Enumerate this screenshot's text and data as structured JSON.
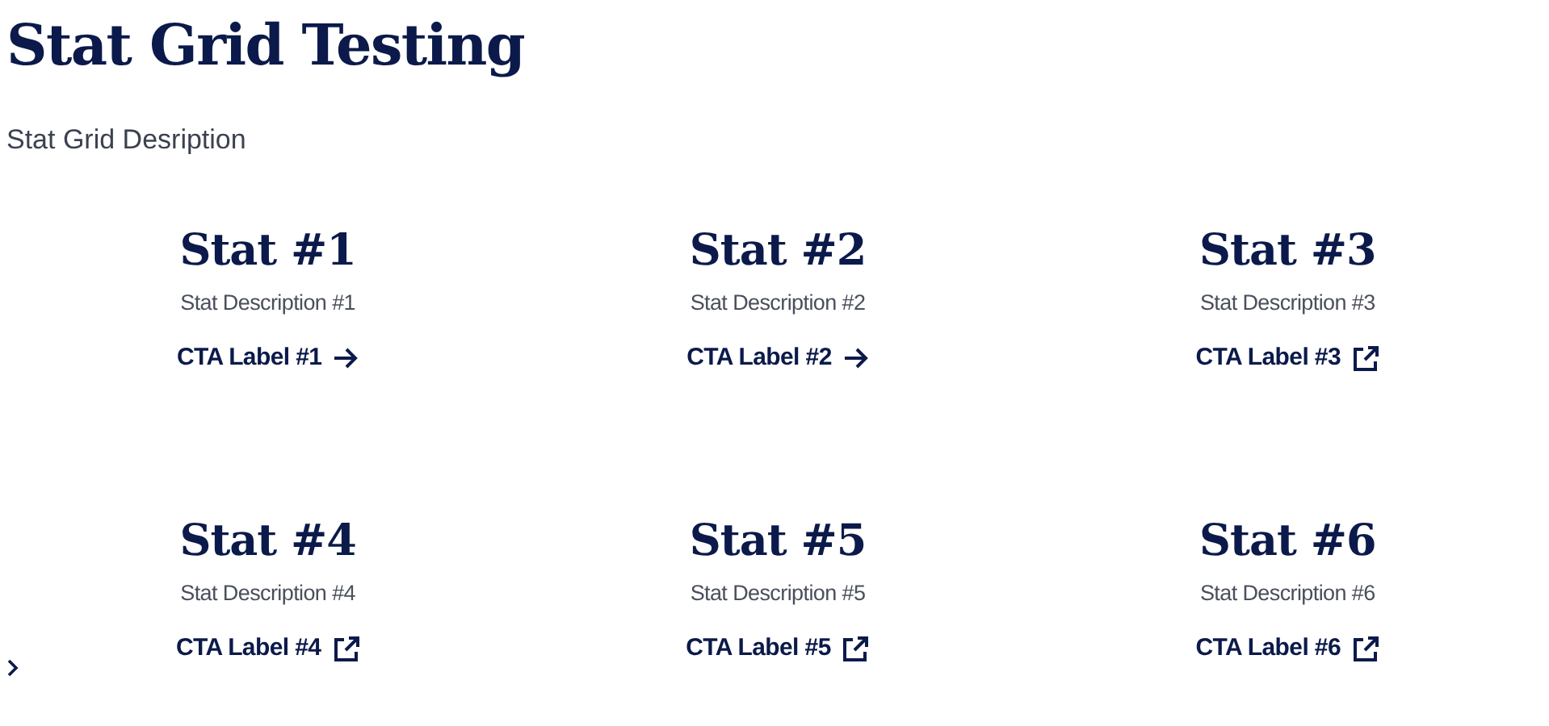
{
  "title": "Stat Grid Testing",
  "description": "Stat Grid Desription",
  "stats": [
    {
      "title": "Stat #1",
      "description": "Stat Description #1",
      "cta": {
        "label": "CTA Label #1",
        "kind": "arrow"
      }
    },
    {
      "title": "Stat #2",
      "description": "Stat Description #2",
      "cta": {
        "label": "CTA Label #2",
        "kind": "arrow"
      }
    },
    {
      "title": "Stat #3",
      "description": "Stat Description #3",
      "cta": {
        "label": "CTA Label #3",
        "kind": "external"
      }
    },
    {
      "title": "Stat #4",
      "description": "Stat Description #4",
      "cta": {
        "label": "CTA Label #4",
        "kind": "external"
      }
    },
    {
      "title": "Stat #5",
      "description": "Stat Description #5",
      "cta": {
        "label": "CTA Label #5",
        "kind": "external"
      }
    },
    {
      "title": "Stat #6",
      "description": "Stat Description #6",
      "cta": {
        "label": "CTA Label #6",
        "kind": "external"
      }
    }
  ]
}
